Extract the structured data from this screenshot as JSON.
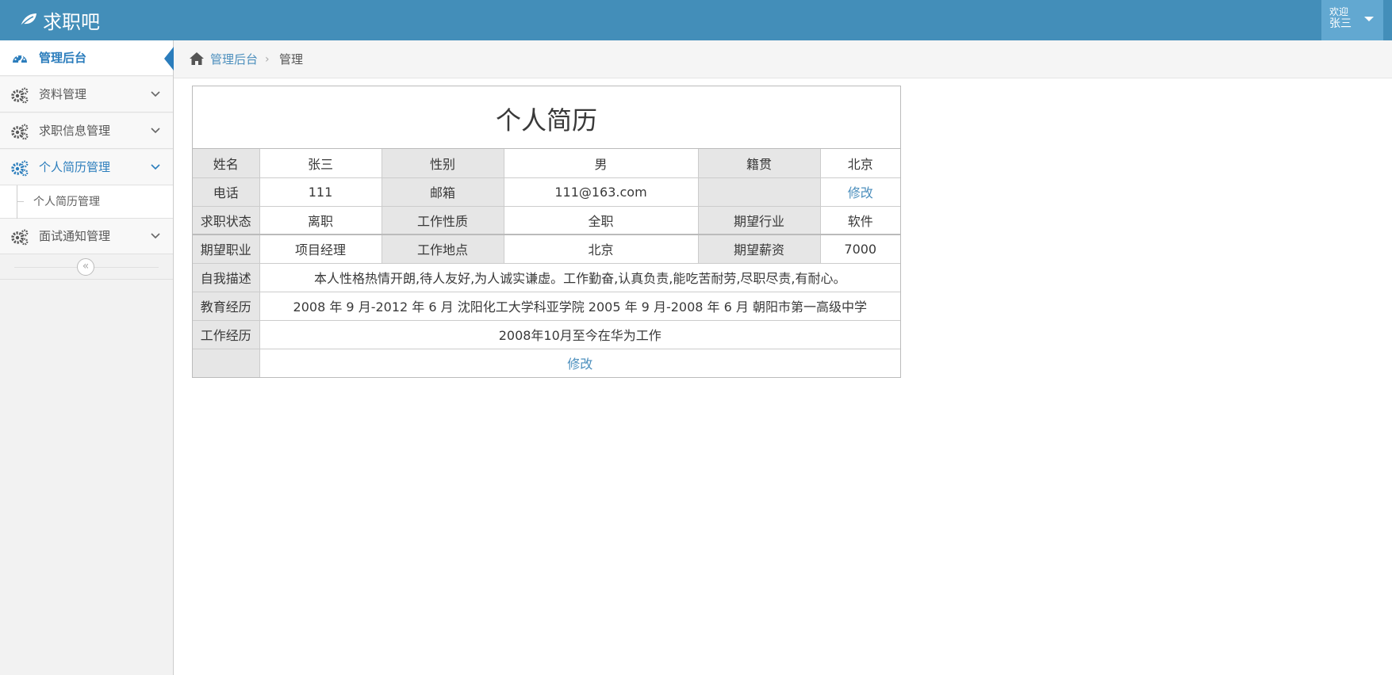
{
  "app": {
    "brand": "求职吧"
  },
  "user_menu": {
    "welcome": "欢迎",
    "name": "张三"
  },
  "sidebar": {
    "items": [
      {
        "label": "管理后台",
        "icon": "dashboard-icon",
        "active": true
      },
      {
        "label": "资料管理",
        "icon": "gears-icon"
      },
      {
        "label": "求职信息管理",
        "icon": "gears-icon"
      },
      {
        "label": "个人简历管理",
        "icon": "gears-icon",
        "open": true
      },
      {
        "label": "面试通知管理",
        "icon": "gears-icon"
      }
    ],
    "submenu": {
      "label": "个人简历管理"
    },
    "collapse_icon": "double-chevron-left-icon"
  },
  "breadcrumb": {
    "home": "管理后台",
    "separator": "›",
    "current": "管理"
  },
  "resume": {
    "title": "个人简历",
    "fields": {
      "name_label": "姓名",
      "name": "张三",
      "gender_label": "性别",
      "gender": "男",
      "origin_label": "籍贯",
      "origin": "北京",
      "phone_label": "电话",
      "phone": "111",
      "email_label": "邮箱",
      "email": "111@163.com",
      "edit_link": "修改",
      "status_label": "求职状态",
      "status": "离职",
      "job_type_label": "工作性质",
      "job_type": "全职",
      "industry_label": "期望行业",
      "industry": "软件",
      "position_label": "期望职业",
      "position": "项目经理",
      "location_label": "工作地点",
      "location": "北京",
      "salary_label": "期望薪资",
      "salary": "7000",
      "self_desc_label": "自我描述",
      "self_desc": "本人性格热情开朗,待人友好,为人诚实谦虚。工作勤奋,认真负责,能吃苦耐劳,尽职尽责,有耐心。",
      "education_label": "教育经历",
      "education": "2008 年 9 月-2012 年 6 月 沈阳化工大学科亚学院 2005 年 9 月-2008 年 6 月 朝阳市第一高级中学",
      "work_label": "工作经历",
      "work": "2008年10月至今在华为工作",
      "bottom_edit": "修改"
    }
  }
}
